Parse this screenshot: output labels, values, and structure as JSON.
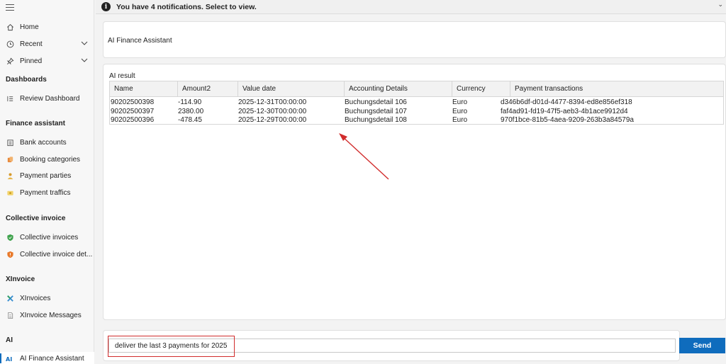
{
  "notification": {
    "text": "You have 4 notifications. Select to view.",
    "icon": "info-icon"
  },
  "sidebar": {
    "top_items": [
      {
        "label": "Home",
        "icon": "home-icon"
      },
      {
        "label": "Recent",
        "icon": "clock-icon"
      },
      {
        "label": "Pinned",
        "icon": "pin-icon"
      }
    ],
    "sections": [
      {
        "title": "Dashboards",
        "items": [
          {
            "label": "Review Dashboard",
            "icon": "dashboard-icon"
          }
        ]
      },
      {
        "title": "Finance assistant",
        "items": [
          {
            "label": "Bank accounts",
            "icon": "bank-icon"
          },
          {
            "label": "Booking categories",
            "icon": "category-icon"
          },
          {
            "label": "Payment parties",
            "icon": "people-icon"
          },
          {
            "label": "Payment traffics",
            "icon": "payment-icon"
          }
        ]
      },
      {
        "title": "Collective invoice",
        "items": [
          {
            "label": "Collective invoices",
            "icon": "invoice-shield-icon"
          },
          {
            "label": "Collective invoice det...",
            "icon": "invoice-detail-icon"
          }
        ]
      },
      {
        "title": "XInvoice",
        "items": [
          {
            "label": "XInvoices",
            "icon": "xinvoice-icon"
          },
          {
            "label": "XInvoice Messages",
            "icon": "document-icon"
          }
        ]
      },
      {
        "title": "AI",
        "items": [
          {
            "label": "AI Finance Assistant",
            "icon": "ai-icon"
          }
        ]
      }
    ]
  },
  "page": {
    "title": "AI Finance Assistant",
    "result_label": "AI result"
  },
  "grid": {
    "columns": [
      "Name",
      "Amount2",
      "Value date",
      "Accounting Details",
      "Currency",
      "Payment transactions"
    ],
    "rows": [
      [
        "90202500398",
        "-114.90",
        "2025-12-31T00:00:00",
        "Buchungsdetail 106",
        "Euro",
        "d346b6df-d01d-4477-8394-ed8e856ef318"
      ],
      [
        "90202500397",
        "2380.00",
        "2025-12-30T00:00:00",
        "Buchungsdetail 107",
        "Euro",
        "faf4ad91-fd19-47f5-aeb3-4b1ace9912d4"
      ],
      [
        "90202500396",
        "-478.45",
        "2025-12-29T00:00:00",
        "Buchungsdetail 108",
        "Euro",
        "970f1bce-81b5-4aea-9209-263b3a84579a"
      ]
    ]
  },
  "chat": {
    "input_value": "deliver the last 3 payments for 2025",
    "send_label": "Send"
  },
  "colors": {
    "accent": "#0f6cbd",
    "annotation": "#d12c2c"
  }
}
